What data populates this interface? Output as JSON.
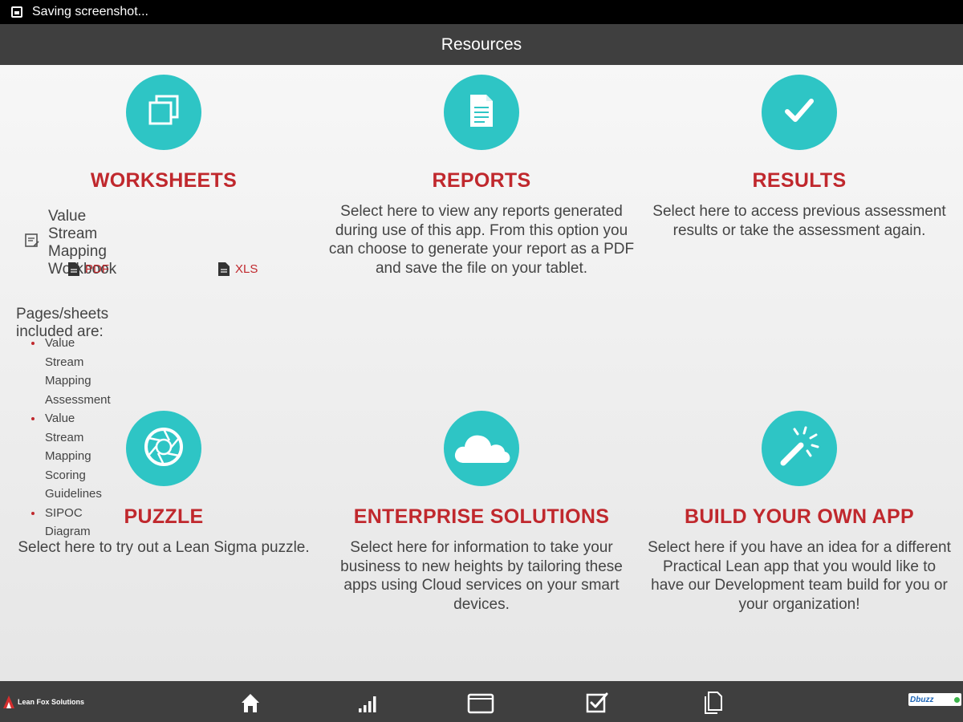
{
  "status_bar": {
    "text": "Saving screenshot..."
  },
  "title_bar": {
    "title": "Resources"
  },
  "cards": {
    "worksheets": {
      "icon": "copy-icon",
      "title": "WORKSHEETS",
      "workbook": "Value Stream Mapping Workbook",
      "pdf_label": "PDF",
      "xls_label": "XLS",
      "pages_label": "Pages/sheets included are:",
      "pages": [
        "Value Stream Mapping Assessment",
        "Value Stream Mapping Scoring Guidelines",
        "SIPOC Diagram"
      ]
    },
    "reports": {
      "icon": "document-icon",
      "title": "REPORTS",
      "description": "Select here to view any reports generated during use of this app. From this option you can choose to generate your report as a PDF and save the file on your tablet."
    },
    "results": {
      "icon": "checkmark-icon",
      "title": "RESULTS",
      "description": "Select here to access previous assessment results or take the assessment again."
    },
    "puzzle": {
      "icon": "aperture-icon",
      "title": "PUZZLE",
      "description": "Select here to try out a Lean Sigma puzzle."
    },
    "enterprise": {
      "icon": "cloud-icon",
      "title": "ENTERPRISE SOLUTIONS",
      "description": "Select here for information to take your business to new heights by tailoring these apps using Cloud services on your smart devices."
    },
    "build": {
      "icon": "magic-wand-icon",
      "title": "BUILD YOUR OWN APP",
      "description": "Select here if you have an idea for a different Practical Lean app that you would like to have our Development team build for you or your organization!"
    }
  },
  "bottom_nav": {
    "left_logo": "Lean Fox Solutions",
    "right_logo": "Dbuzz",
    "items": [
      "home-icon",
      "bar-chart-icon",
      "folder-icon",
      "checkbox-icon",
      "documents-icon"
    ]
  },
  "colors": {
    "accent": "#2ec5c5",
    "title_red": "#c0282d",
    "bar": "#3f3f3f"
  }
}
